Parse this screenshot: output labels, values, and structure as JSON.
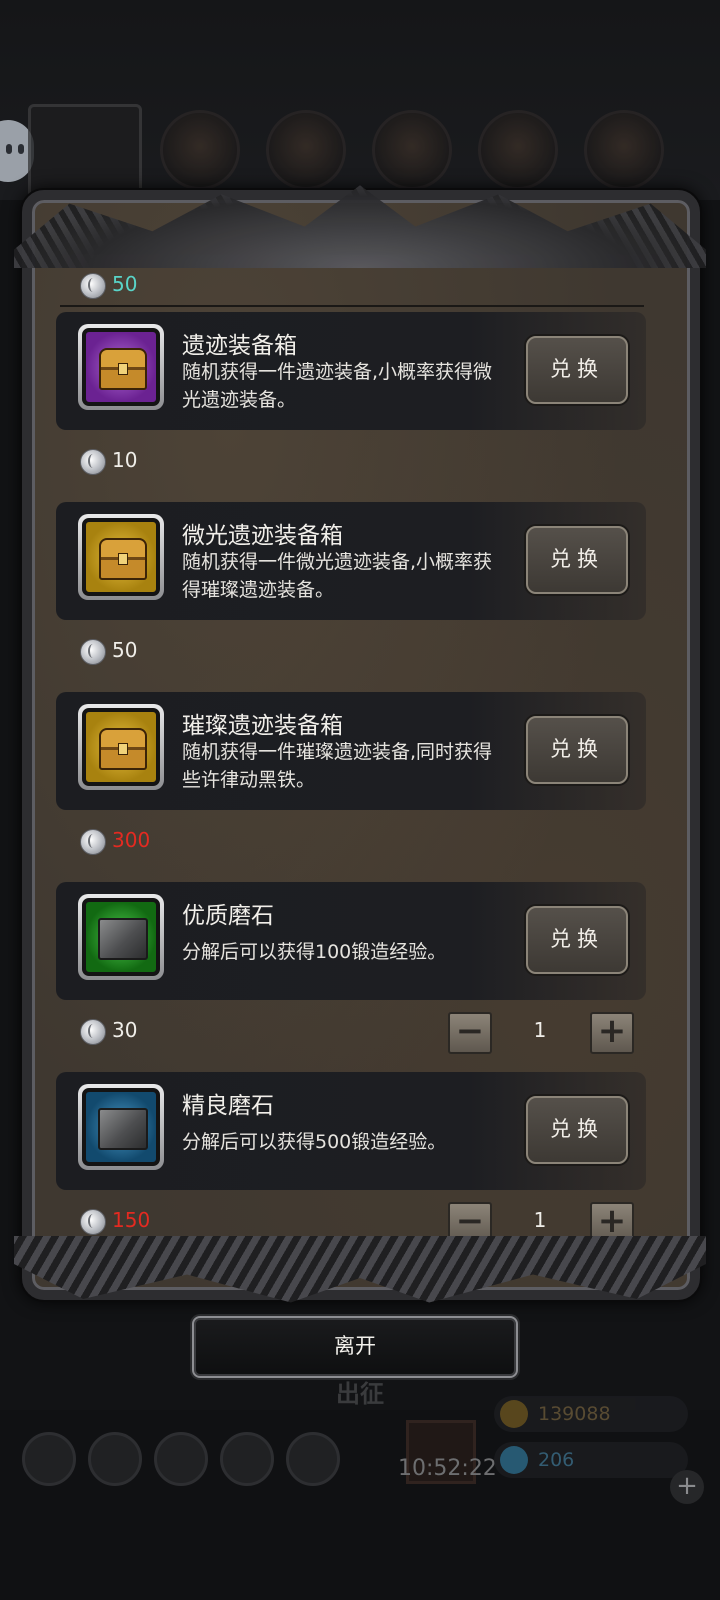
{
  "header": {
    "currency_amount": "50",
    "currency_color": "#59d4c8"
  },
  "items": [
    {
      "name": "遗迹装备箱",
      "desc": "随机获得一件遗迹装备,小概率获得微光遗迹装备。",
      "button": "兑换",
      "price": "10",
      "rarity": "purple",
      "icon": "chest-icon"
    },
    {
      "name": "微光遗迹装备箱",
      "desc": "随机获得一件微光遗迹装备,小概率获得璀璨遗迹装备。",
      "button": "兑换",
      "price": "50",
      "rarity": "gold",
      "icon": "chest-icon"
    },
    {
      "name": "璀璨遗迹装备箱",
      "desc": "随机获得一件璀璨遗迹装备,同时获得些许律动黑铁。",
      "button": "兑换",
      "price": "300",
      "price_color": "#e42a21",
      "rarity": "gold",
      "icon": "chest-icon"
    },
    {
      "name": "优质磨石",
      "desc": "分解后可以获得100锻造经验。",
      "button": "兑换",
      "price": "30",
      "quantity": "1",
      "rarity": "green",
      "icon": "stone-icon"
    },
    {
      "name": "精良磨石",
      "desc": "分解后可以获得500锻造经验。",
      "button": "兑换",
      "price": "150",
      "price_color": "#e42a21",
      "quantity": "1",
      "rarity": "blue",
      "icon": "stone-icon"
    }
  ],
  "leave_button": "离开",
  "background": {
    "tab_label": "出征",
    "gold": "139088",
    "gems": "206",
    "time": "10:52:22"
  }
}
